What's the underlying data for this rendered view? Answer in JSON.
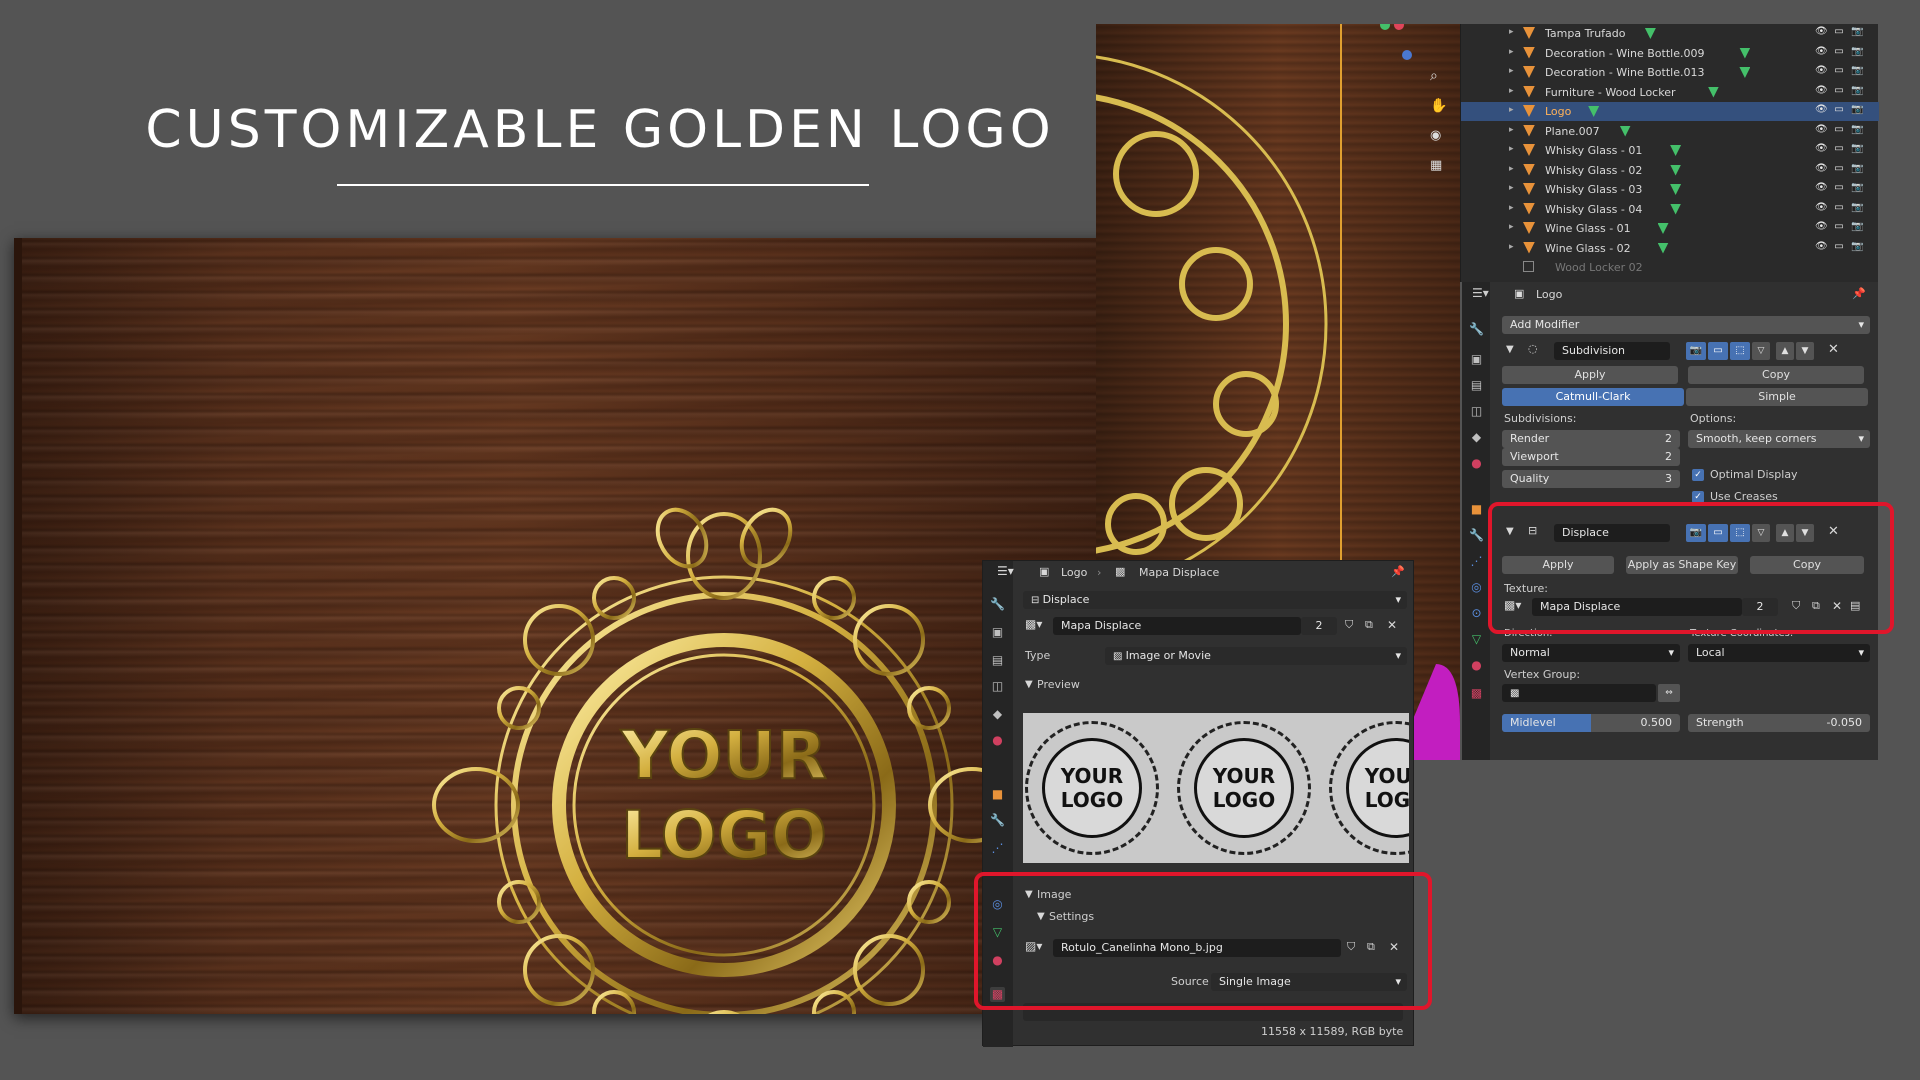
{
  "headline": "CUSTOMIZABLE GOLDEN LOGO",
  "scene": {
    "logo_line1": "YOUR",
    "logo_line2": "LOGO"
  },
  "outliner": {
    "rows": [
      {
        "name": "Tampa Trufado",
        "selected": false
      },
      {
        "name": "Decoration - Wine Bottle.009",
        "selected": false
      },
      {
        "name": "Decoration - Wine Bottle.013",
        "selected": false
      },
      {
        "name": "Furniture - Wood Locker",
        "selected": false
      },
      {
        "name": "Logo",
        "selected": true
      },
      {
        "name": "Plane.007",
        "selected": false
      },
      {
        "name": "Whisky Glass - 01",
        "selected": false
      },
      {
        "name": "Whisky Glass - 02",
        "selected": false
      },
      {
        "name": "Whisky Glass - 03",
        "selected": false
      },
      {
        "name": "Whisky Glass - 04",
        "selected": false
      },
      {
        "name": "Wine Glass - 01",
        "selected": false
      },
      {
        "name": "Wine Glass - 02",
        "selected": false
      },
      {
        "name": "Wood Locker 02",
        "selected": false
      }
    ]
  },
  "modifier_panel": {
    "object_name": "Logo",
    "add_modifier": "Add Modifier",
    "subdivision": {
      "name": "Subdivision",
      "apply": "Apply",
      "copy": "Copy",
      "catmull": "Catmull-Clark",
      "simple": "Simple",
      "subdivisions_label": "Subdivisions:",
      "options_label": "Options:",
      "render_label": "Render",
      "render_value": "2",
      "viewport_label": "Viewport",
      "viewport_value": "2",
      "quality_label": "Quality",
      "quality_value": "3",
      "uv_option": "Smooth, keep corners",
      "optimal_display": "Optimal Display",
      "use_creases": "Use Creases"
    },
    "displace": {
      "name": "Displace",
      "apply": "Apply",
      "apply_shape_key": "Apply as Shape Key",
      "copy": "Copy",
      "texture_label": "Texture:",
      "texture_name": "Mapa Displace",
      "texture_users": "2",
      "direction_label": "Direction:",
      "direction_value": "Normal",
      "texcoords_label": "Texture Coordinates:",
      "texcoords_value": "Local",
      "vertex_group_label": "Vertex Group:",
      "midlevel_label": "Midlevel",
      "midlevel_value": "0.500",
      "midlevel_fraction": 0.5,
      "strength_label": "Strength",
      "strength_value": "-0.050"
    }
  },
  "texture_panel": {
    "object_name": "Logo",
    "texture_name": "Mapa Displace",
    "modifier_select": "Displace",
    "texture_field": "Mapa Displace",
    "texture_users": "2",
    "type_label": "Type",
    "type_value": "Image or Movie",
    "preview_label": "Preview",
    "preview_logo_line1": "YOUR",
    "preview_logo_line2": "LOGO",
    "image_label": "Image",
    "settings_label": "Settings",
    "image_file": "Rotulo_Canelinha Mono_b.jpg",
    "source_label": "Source",
    "source_value": "Single Image",
    "image_info": "11558 x 11589,  RGB byte"
  },
  "colors": {
    "accent": "#4772b3",
    "highlight": "#e0162b",
    "gold": "#d4b040"
  }
}
